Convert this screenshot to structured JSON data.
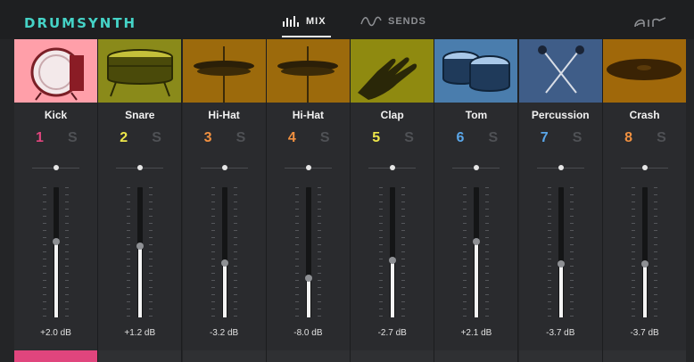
{
  "header": {
    "logo": "DRUMSYNTH",
    "tabs": [
      {
        "label": "MIX",
        "active": true
      },
      {
        "label": "SENDS",
        "active": false
      }
    ],
    "brand": "air"
  },
  "colors": {
    "accent": "#45d3c7",
    "kick_bg": "#ff9fa9",
    "snare_bg": "#8a8a1a",
    "hat_bg": "#9c6a0c",
    "clap_bg": "#8f8a10",
    "tom_bg": "#4a7dad",
    "perc_bg": "#3f5d88",
    "crash_bg": "#a0680a",
    "active_bar": "#e0457d"
  },
  "channels": [
    {
      "name": "Kick",
      "number": "1",
      "solo": "S",
      "db": "+2.0 dB",
      "number_color": "#e0457d",
      "thumb_color": "#ff9fa9",
      "icon": "kick-drum-icon",
      "level": 0.58
    },
    {
      "name": "Snare",
      "number": "2",
      "solo": "S",
      "db": "+1.2 dB",
      "number_color": "#ede64a",
      "thumb_color": "#8a8a1a",
      "icon": "snare-drum-icon",
      "level": 0.55
    },
    {
      "name": "Hi-Hat",
      "number": "3",
      "solo": "S",
      "db": "-3.2 dB",
      "number_color": "#f09040",
      "thumb_color": "#9c6a0c",
      "icon": "hi-hat-icon",
      "level": 0.42
    },
    {
      "name": "Hi-Hat",
      "number": "4",
      "solo": "S",
      "db": "-8.0 dB",
      "number_color": "#f09040",
      "thumb_color": "#9c6a0c",
      "icon": "hi-hat-icon",
      "level": 0.3
    },
    {
      "name": "Clap",
      "number": "5",
      "solo": "S",
      "db": "-2.7 dB",
      "number_color": "#ede64a",
      "thumb_color": "#8f8a10",
      "icon": "clap-hand-icon",
      "level": 0.44
    },
    {
      "name": "Tom",
      "number": "6",
      "solo": "S",
      "db": "+2.1 dB",
      "number_color": "#5aa6e8",
      "thumb_color": "#4a7dad",
      "icon": "tom-drums-icon",
      "level": 0.58
    },
    {
      "name": "Percussion",
      "number": "7",
      "solo": "S",
      "db": "-3.7 dB",
      "number_color": "#5aa6e8",
      "thumb_color": "#3f5d88",
      "icon": "mallets-icon",
      "level": 0.41
    },
    {
      "name": "Crash",
      "number": "8",
      "solo": "S",
      "db": "-3.7 dB",
      "number_color": "#f09040",
      "thumb_color": "#a0680a",
      "icon": "crash-cymbal-icon",
      "level": 0.41
    }
  ]
}
